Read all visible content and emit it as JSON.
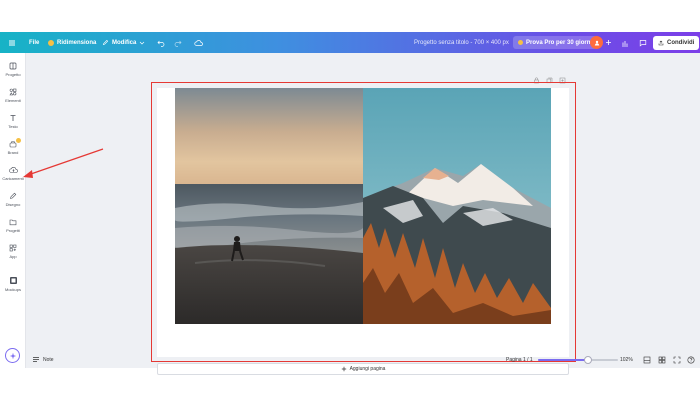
{
  "topbar": {
    "file": "File",
    "resize": "Ridimensiona",
    "edit": "Modifica",
    "project_title": "Progetto senza titolo - 700 × 400 px",
    "pro_trial": "Prova Pro per 30 giorni",
    "share": "Condividi"
  },
  "sidebar": {
    "items": [
      {
        "label": "Progetto",
        "icon": "layout-icon"
      },
      {
        "label": "Elementi",
        "icon": "shapes-icon"
      },
      {
        "label": "Testo",
        "icon": "text-icon"
      },
      {
        "label": "Brand",
        "icon": "brand-icon"
      },
      {
        "label": "Caricamenti",
        "icon": "cloud-upload-icon"
      },
      {
        "label": "Disegno",
        "icon": "pen-icon"
      },
      {
        "label": "Progetti",
        "icon": "folder-icon"
      },
      {
        "label": "App",
        "icon": "apps-icon"
      },
      {
        "label": "Mockups",
        "icon": "mockup-icon"
      }
    ]
  },
  "canvas": {
    "add_page": "Aggiungi pagina",
    "left_photo": "beach-sunset-photo",
    "right_photo": "snowy-mountain-photo"
  },
  "bottombar": {
    "notes": "Note",
    "page_indicator": "Pagina 1 / 1",
    "zoom": "102%",
    "zoom_fraction": 0.62
  },
  "colors": {
    "accent": "#7b6cf0",
    "selection": "#e53935",
    "annotation_arrow": "#e53935",
    "topbar_start": "#17b3c6",
    "topbar_end": "#7c3fe8"
  }
}
